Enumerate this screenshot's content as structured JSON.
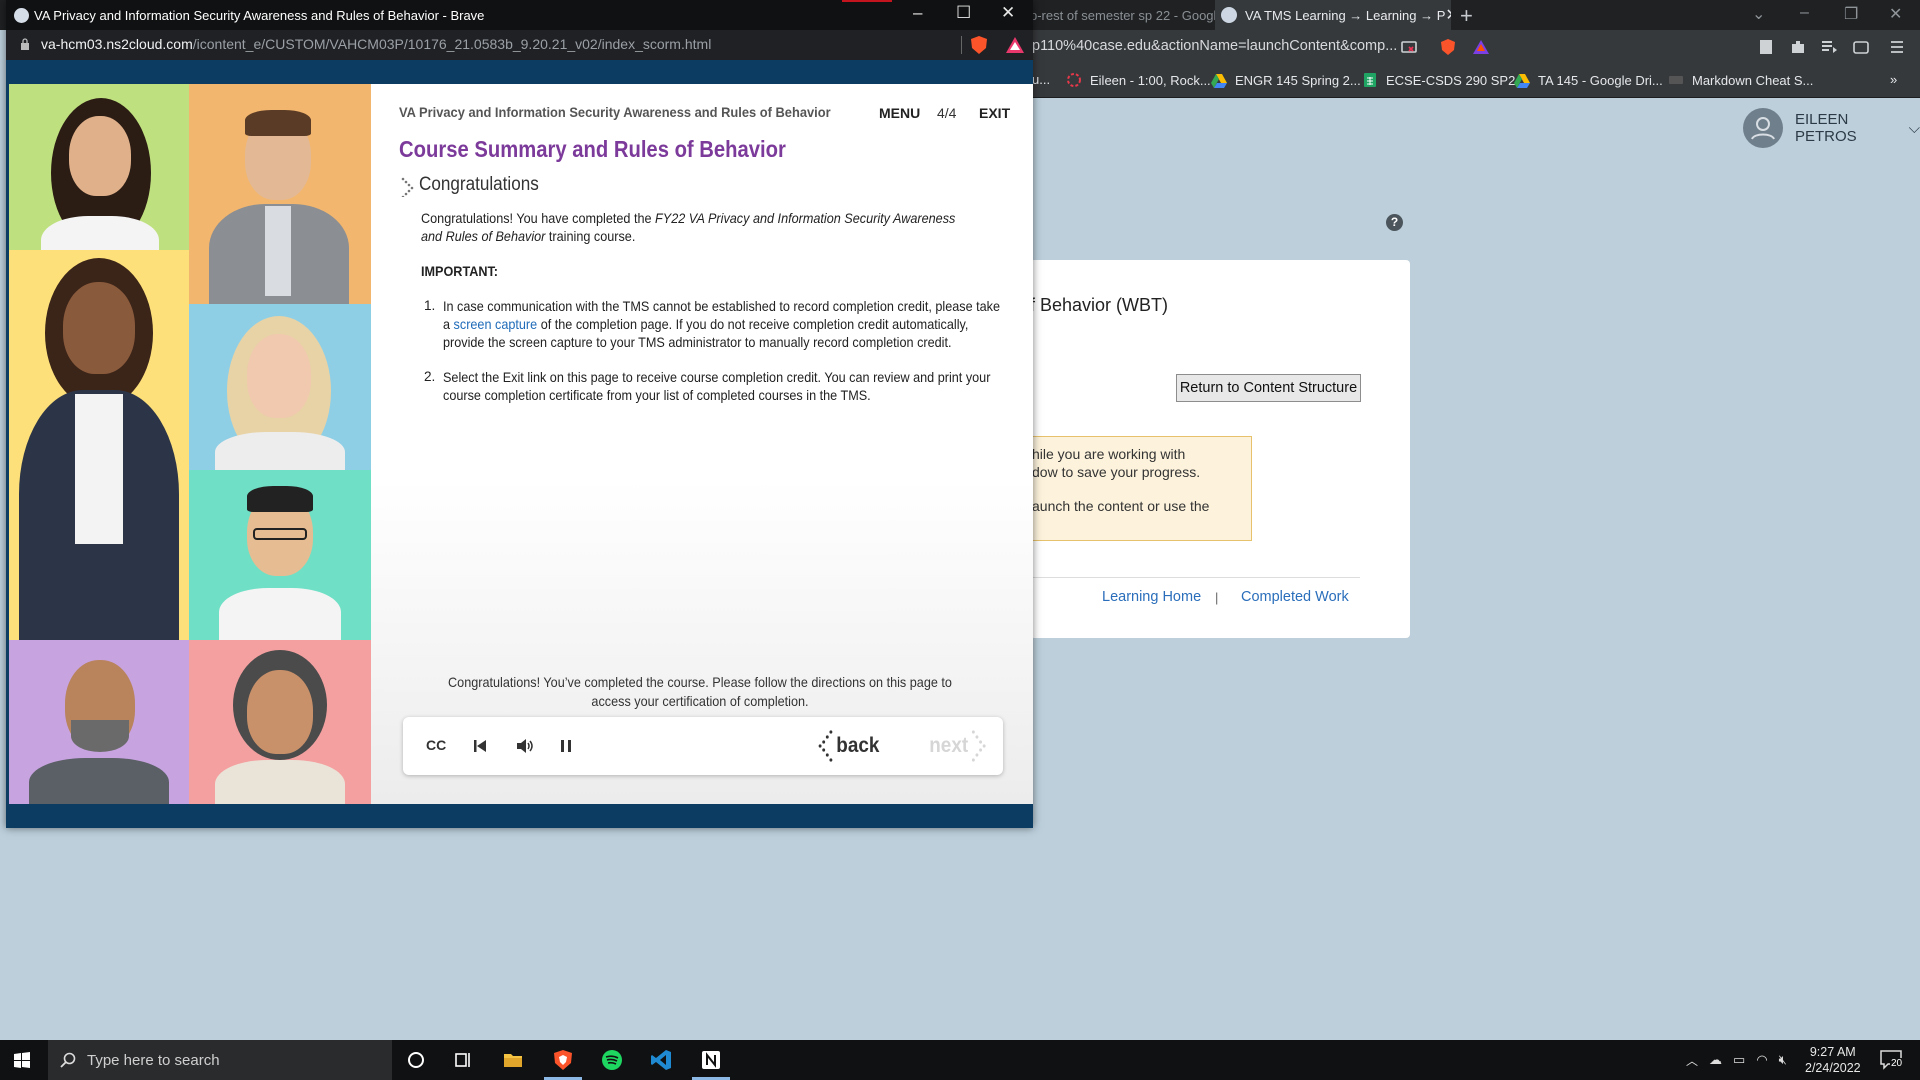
{
  "bg_browser": {
    "tab1_title": "p-rest of semester sp 22 - Googl",
    "tab2_title": "VA TMS Learning → Learning → P",
    "url": "p110%40case.edu&actionName=launchContent&comp...",
    "bookmarks": [
      {
        "label": "u..."
      },
      {
        "label": "Eileen - 1:00, Rock..."
      },
      {
        "label": "ENGR 145 Spring 2..."
      },
      {
        "label": "ECSE-CSDS 290 SP2..."
      },
      {
        "label": "TA 145 - Google Dri..."
      },
      {
        "label": "Markdown Cheat S..."
      }
    ],
    "user_name": "EILEEN PETROS",
    "help_label": "?",
    "course_title_partial": "f Behavior (WBT)",
    "return_button": "Return to Content Structure",
    "warn_lines": [
      "hile you are working with",
      "dow to save your progress.",
      "aunch the content or use the"
    ],
    "link_home": "Learning Home",
    "link_separator": "|",
    "link_completed": "Completed Work"
  },
  "popup": {
    "window_title": "VA Privacy and Information Security Awareness and Rules of Behavior - Brave",
    "url_host": "va-hcm03.ns2cloud.com",
    "url_path": "/icontent_e/CUSTOM/VAHCM03P/10176_21.0583b_9.20.21_v02/index_scorm.html"
  },
  "course": {
    "header": "VA Privacy and Information Security Awareness and Rules of Behavior",
    "menu_label": "MENU",
    "page_indicator": "4/4",
    "exit_label": "EXIT",
    "title": "Course Summary and Rules of Behavior",
    "section_title": "Congratulations",
    "congrats_pre": "Congratulations! You have completed the ",
    "congrats_course": "FY22 VA Privacy and Information Security Awareness and Rules of Behavior",
    "congrats_post": " training course.",
    "important_label": "IMPORTANT:",
    "item1_pre": "In case communication with the TMS cannot be established to record completion credit, please take a ",
    "item1_link": "screen capture",
    "item1_post": " of the completion page. If you do not receive completion credit automatically, provide the screen capture to your TMS administrator to manually record completion credit.",
    "item2": "Select the Exit link on this page to receive course completion credit. You can review and print your course completion certificate from your list of completed courses in the TMS.",
    "footer_message": "Congratulations! You’ve completed the course. Please follow the directions on this page to access your certification of completion.",
    "nav": {
      "cc_label": "CC",
      "back_label": "back",
      "next_label": "next"
    }
  },
  "taskbar": {
    "search_placeholder": "Type here to search",
    "time": "9:27 AM",
    "date": "2/24/2022",
    "notification_count": "20"
  },
  "colors": {
    "accent_purple": "#7c3a9a",
    "link_blue": "#1f6bb9",
    "frame_navy": "#0d3c63",
    "page_background": "#bccfdb"
  }
}
